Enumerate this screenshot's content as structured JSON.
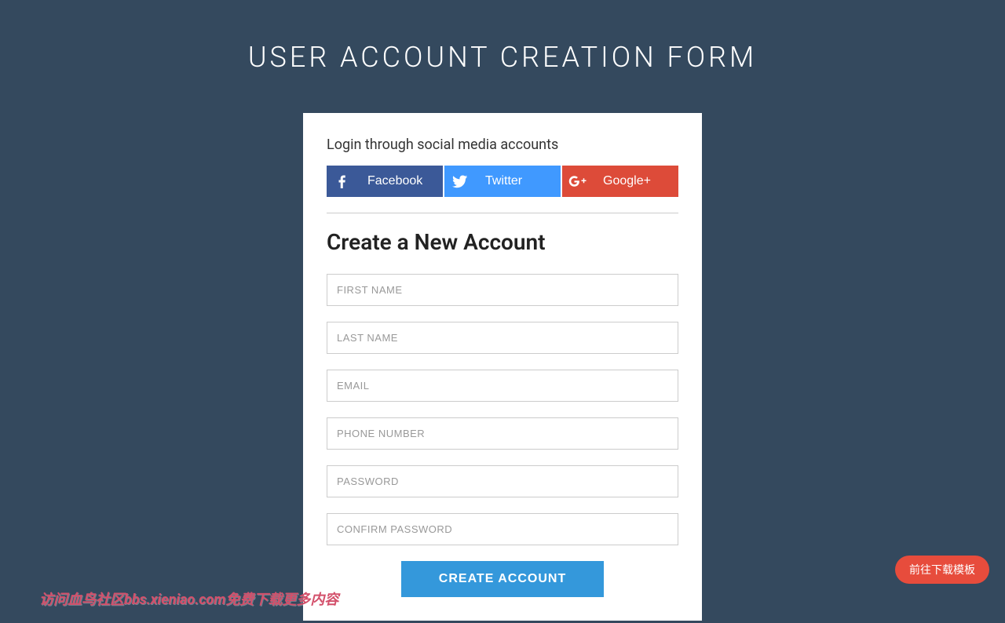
{
  "header": {
    "title": "USER ACCOUNT CREATION FORM"
  },
  "social": {
    "intro_text": "Login through social media accounts",
    "buttons": {
      "facebook": "Facebook",
      "twitter": "Twitter",
      "google": "Google+"
    }
  },
  "form": {
    "heading": "Create a New Account",
    "placeholders": {
      "first_name": "FIRST NAME",
      "last_name": "LAST NAME",
      "email": "EMAIL",
      "phone": "PHONE NUMBER",
      "password": "PASSWORD",
      "confirm_password": "CONFIRM PASSWORD"
    },
    "submit_label": "CREATE ACCOUNT"
  },
  "floating_button": {
    "label": "前往下载模板"
  },
  "watermark": {
    "text": "访问血鸟社区bbs.xieniao.com免费下载更多内容"
  }
}
